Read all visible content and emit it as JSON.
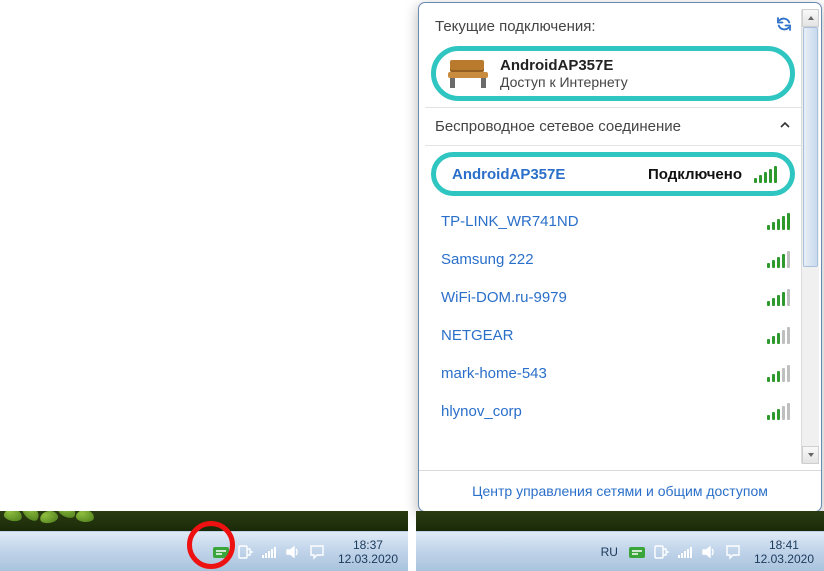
{
  "flyout": {
    "current_header": "Текущие подключения:",
    "current": {
      "name": "AndroidAP357E",
      "status": "Доступ к Интернету"
    },
    "wireless_header": "Беспроводное сетевое соединение",
    "connected_label": "Подключено",
    "networks": [
      {
        "name": "AndroidAP357E",
        "signal": 5,
        "connected": true
      },
      {
        "name": "TP-LINK_WR741ND",
        "signal": 5,
        "connected": false
      },
      {
        "name": "Samsung 222",
        "signal": 4,
        "connected": false
      },
      {
        "name": "WiFi-DOM.ru-9979",
        "signal": 4,
        "connected": false
      },
      {
        "name": "NETGEAR",
        "signal": 3,
        "connected": false
      },
      {
        "name": "mark-home-543",
        "signal": 3,
        "connected": false
      },
      {
        "name": "hlynov_corp",
        "signal": 3,
        "connected": false
      }
    ],
    "footer_link": "Центр управления сетями и общим доступом"
  },
  "taskbar_left": {
    "time": "18:37",
    "date": "12.03.2020"
  },
  "taskbar_right": {
    "lang": "RU",
    "time": "18:41",
    "date": "12.03.2020"
  },
  "icons": {
    "refresh": "refresh-icon",
    "chevron": "chevron-up-icon"
  }
}
